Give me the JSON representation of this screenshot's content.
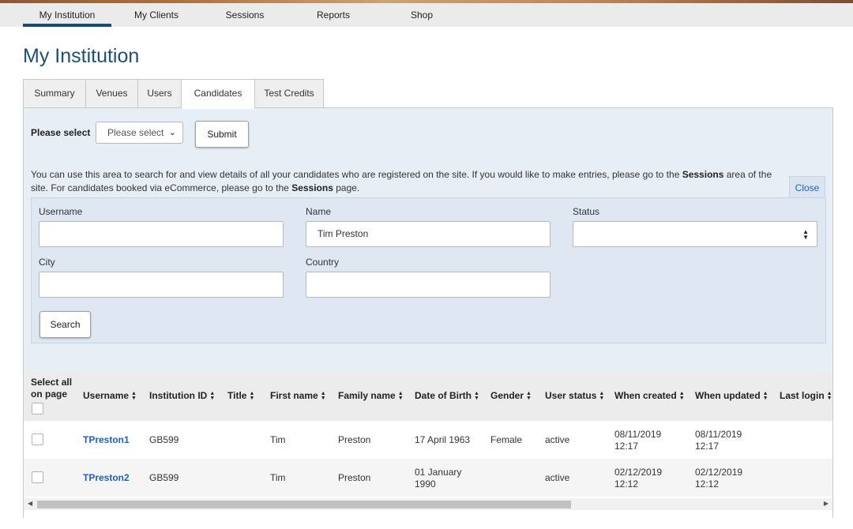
{
  "top_nav": {
    "items": [
      {
        "label": "My Institution",
        "active": true
      },
      {
        "label": "My Clients"
      },
      {
        "label": "Sessions"
      },
      {
        "label": "Reports"
      },
      {
        "label": "Shop"
      }
    ]
  },
  "page": {
    "title": "My Institution"
  },
  "tabs": [
    {
      "label": "Summary"
    },
    {
      "label": "Venues"
    },
    {
      "label": "Users"
    },
    {
      "label": "Candidates",
      "active": true
    },
    {
      "label": "Test Credits"
    }
  ],
  "selector": {
    "label": "Please select",
    "value": "Please select",
    "submit_label": "Submit"
  },
  "info": {
    "part1": "You can use this area to search for and view details of all your candidates who are registered on the site. If you would like to make entries, please go to the ",
    "bold1": "Sessions",
    "part2": " area of the site. For candidates booked via eCommerce, please go to the ",
    "bold2": "Sessions",
    "part3": " page."
  },
  "close_label": "Close",
  "search": {
    "username": {
      "label": "Username",
      "value": ""
    },
    "name": {
      "label": "Name",
      "value": "Tim Preston"
    },
    "status": {
      "label": "Status",
      "value": ""
    },
    "city": {
      "label": "City",
      "value": ""
    },
    "country": {
      "label": "Country",
      "value": ""
    },
    "button_label": "Search"
  },
  "table": {
    "select_all_label_1": "Select all",
    "select_all_label_2": "on page",
    "headers": {
      "username": "Username",
      "institution_id": "Institution ID",
      "title": "Title",
      "first_name": "First name",
      "family_name": "Family name",
      "dob": "Date of Birth",
      "gender": "Gender",
      "user_status": "User status",
      "when_created": "When created",
      "when_updated": "When updated",
      "last_login": "Last login"
    },
    "rows": [
      {
        "username": "TPreston1",
        "institution_id": "GB599",
        "title": "",
        "first_name": "Tim",
        "family_name": "Preston",
        "dob_1": "17 April 1963",
        "dob_2": "",
        "gender": "Female",
        "user_status": "active",
        "created_date": "08/11/2019",
        "created_time": "12:17",
        "updated_date": "08/11/2019",
        "updated_time": "12:17",
        "last_login": ""
      },
      {
        "username": "TPreston2",
        "institution_id": "GB599",
        "title": "",
        "first_name": "Tim",
        "family_name": "Preston",
        "dob_1": "01 January",
        "dob_2": "1990",
        "gender": "",
        "user_status": "active",
        "created_date": "02/12/2019",
        "created_time": "12:12",
        "updated_date": "02/12/2019",
        "updated_time": "12:12",
        "last_login": ""
      }
    ]
  },
  "colors": {
    "accent": "#1d4a6e",
    "title": "#1f4f74",
    "link": "#1f5fbf",
    "panel_bg": "#e8eef6",
    "search_bg": "#dfe7f3"
  }
}
